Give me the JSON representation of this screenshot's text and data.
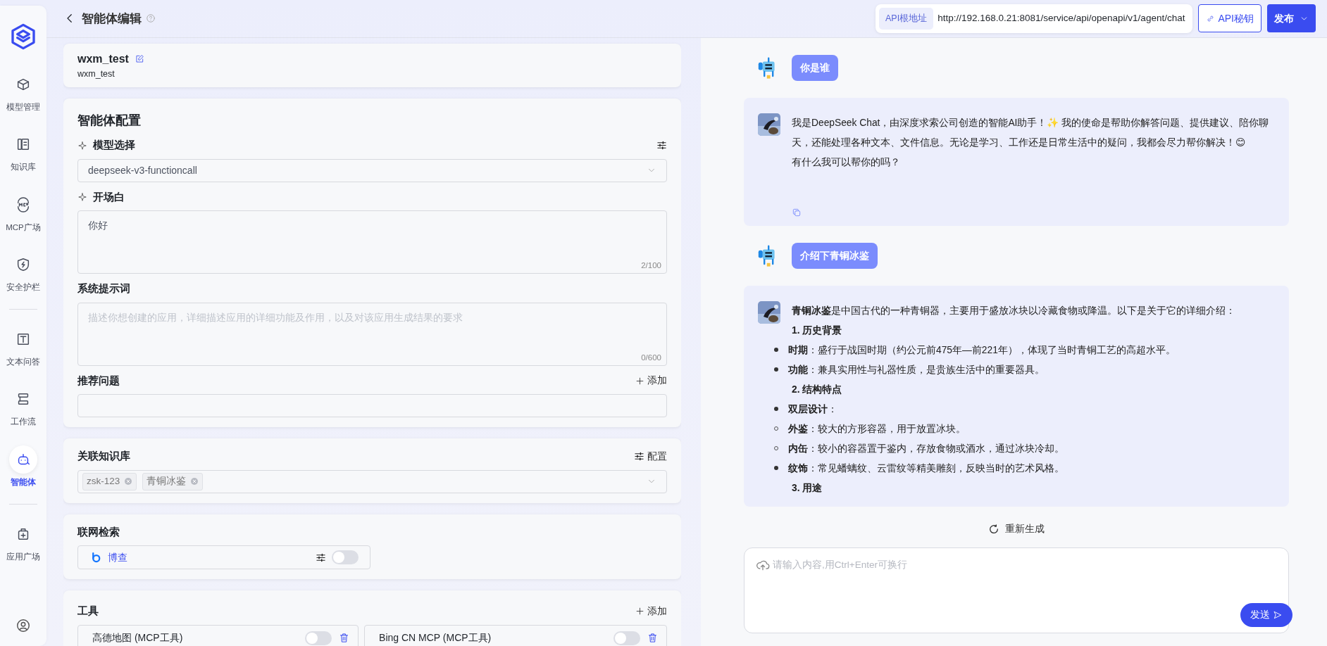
{
  "sidebar": {
    "groups": [
      [
        {
          "label": "模型管理",
          "selected": false
        },
        {
          "label": "知识库",
          "selected": false
        },
        {
          "label": "MCP广场",
          "selected": false
        },
        {
          "label": "安全护栏",
          "selected": false
        }
      ],
      [
        {
          "label": "文本问答",
          "selected": false
        },
        {
          "label": "工作流",
          "selected": false
        },
        {
          "label": "智能体",
          "selected": true
        }
      ],
      [
        {
          "label": "应用广场",
          "selected": false
        }
      ]
    ]
  },
  "header": {
    "title": "智能体编辑",
    "api_label": "API根地址",
    "api_url": "http://192.168.0.21:8081/service/api/openapi/v1/agent/chat",
    "api_key_button": "API秘钥",
    "publish_button": "发布"
  },
  "agent": {
    "name": "wxm_test",
    "description": "wxm_test"
  },
  "config": {
    "title": "智能体配置",
    "model": {
      "label": "模型选择",
      "value": "deepseek-v3-functioncall"
    },
    "opening": {
      "label": "开场白",
      "value": "你好",
      "counter": "2/100"
    },
    "system_prompt": {
      "label": "系统提示词",
      "placeholder": "描述你想创建的应用，详细描述应用的详细功能及作用，以及对该应用生成结果的要求",
      "counter": "0/600"
    },
    "suggested": {
      "label": "推荐问题",
      "add": "添加"
    }
  },
  "knowledge": {
    "label": "关联知识库",
    "config": "配置",
    "tags": [
      "zsk-123",
      "青铜冰鉴"
    ]
  },
  "web_search": {
    "label": "联网检索",
    "providers": [
      {
        "name": "博查",
        "on": false
      }
    ]
  },
  "tools": {
    "label": "工具",
    "add": "添加",
    "items": [
      {
        "name": "高德地图 (MCP工具)",
        "on": false
      },
      {
        "name": "Bing CN MCP (MCP工具)",
        "on": false
      }
    ]
  },
  "chat": {
    "messages": [
      {
        "kind": "user",
        "text": "你是谁"
      },
      {
        "kind": "assistant",
        "blocks": [
          {
            "kind": "paragraph",
            "text": "我是DeepSeek Chat，由深度求索公司创造的智能AI助手！✨ 我的使命是帮助你解答问题、提供建议、陪你聊天，还能处理各种文本、文件信息。无论是学习、工作还是日常生活中的疑问，我都会尽力帮你解决！😊"
          },
          {
            "kind": "paragraph",
            "text": "有什么我可以帮你的吗？"
          }
        ]
      },
      {
        "kind": "user",
        "text": "介绍下青铜冰鉴"
      },
      {
        "kind": "assistant",
        "blocks": [
          {
            "kind": "paragraph",
            "text": "**青铜冰鉴**是中国古代的一种青铜器，主要用于盛放冰块以冷藏食物或降温。以下是关于它的详细介绍："
          },
          {
            "kind": "heading",
            "text": "1. 历史背景"
          },
          {
            "kind": "bullet",
            "text": "**时期**：盛行于战国时期（约公元前475年—前221年），体现了当时青铜工艺的高超水平。"
          },
          {
            "kind": "bullet",
            "text": "**功能**：兼具实用性与礼器性质，是贵族生活中的重要器具。"
          },
          {
            "kind": "heading",
            "text": "2. 结构特点"
          },
          {
            "kind": "bullet",
            "text": "**双层设计**："
          },
          {
            "kind": "sub_bullet",
            "text": "**外鉴**：较大的方形容器，用于放置冰块。"
          },
          {
            "kind": "sub_bullet",
            "text": "**内缶**：较小的容器置于鉴内，存放食物或酒水，通过冰块冷却。"
          },
          {
            "kind": "bullet",
            "text": "**纹饰**：常见蟠螭纹、云雷纹等精美雕刻，反映当时的艺术风格。"
          },
          {
            "kind": "heading",
            "text": "3. 用途"
          }
        ]
      }
    ],
    "regenerate": "重新生成",
    "input_placeholder": "请输入内容,用Ctrl+Enter可换行",
    "send": "发送"
  }
}
